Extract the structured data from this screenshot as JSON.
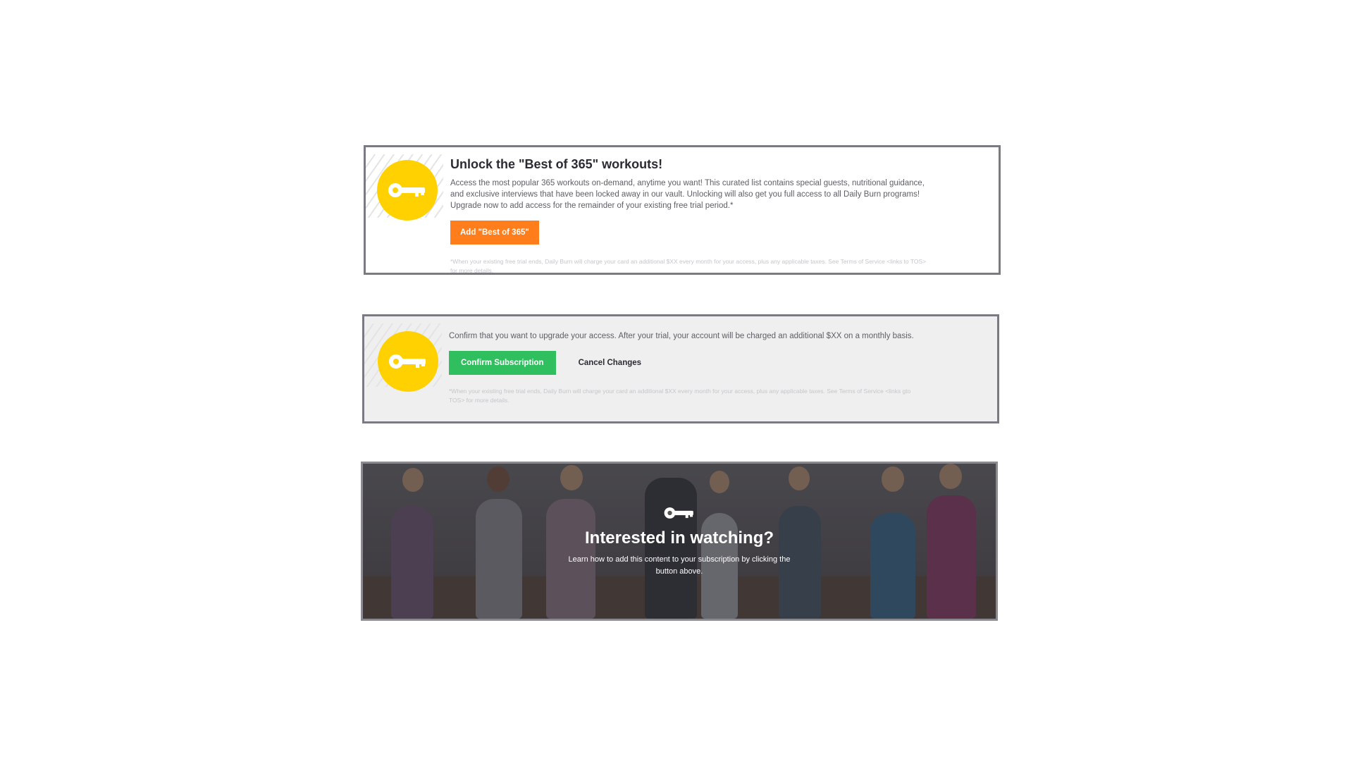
{
  "unlock_card": {
    "title": "Unlock the \"Best of 365\" workouts!",
    "body": "Access the most popular 365 workouts on-demand, anytime you want! This curated list contains special guests, nutritional guidance, and exclusive interviews that have been locked away in our vault. Unlocking will also get you full access to all Daily Burn programs! Upgrade now to add access for the remainder of your existing free trial period.*",
    "button_label": "Add \"Best of 365\"",
    "fine_print": "*When your existing free trial ends, Daily Burn will charge your card an additional $XX every month for your access, plus any applicable taxes. See Terms of Service <links to TOS> for more details.",
    "icon": "key-icon",
    "badge_color": "#ffd100",
    "button_color": "#ff7e1b"
  },
  "confirm_card": {
    "body": "Confirm that you want to upgrade your access. After your trial, your account will be charged an additional $XX on a monthly basis.",
    "confirm_label": "Confirm Subscription",
    "cancel_label": "Cancel Changes",
    "fine_print": "*When your existing free trial ends, Daily Burn will charge your card an additional $XX every month for your access, plus any applicable taxes. See Terms of Service <links gto TOS> for more details.",
    "icon": "key-icon",
    "confirm_color": "#2fbf5f"
  },
  "video_card": {
    "title": "Interested in watching?",
    "subtitle": "Learn how to add this content to your subscription by clicking the button above.",
    "icon": "key-icon"
  }
}
